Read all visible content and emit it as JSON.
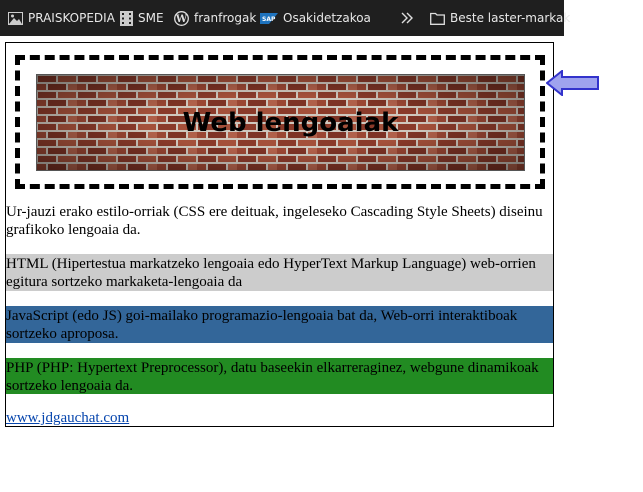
{
  "bookmarks": [
    {
      "label": "PRAISKOPEDIA",
      "icon": "image-icon"
    },
    {
      "label": "SME",
      "icon": "film-icon"
    },
    {
      "label": "franfrogak",
      "icon": "wordpress-icon"
    },
    {
      "label": "Osakidetzakoa",
      "icon": "sap-icon"
    }
  ],
  "more_icon": "chevron-double-right-icon",
  "folder": {
    "label": "Beste laster-markak",
    "icon": "folder-icon"
  },
  "banner": {
    "title": "Web lengoaiak"
  },
  "paragraphs": {
    "css": "Ur-jauzi erako estilo-orriak (CSS ere deituak, ingeleseko Cascading Style Sheets) diseinu grafikoko lengoaia da.",
    "html": "HTML (Hipertestua markatzeko lengoaia edo HyperText Markup Language) web-orrien egitura sortzeko markaketa-lengoaia da",
    "js": "JavaScript (edo JS) goi-mailako programazio-lengoaia bat da, Web-orri interaktiboak sortzeko aproposa.",
    "php": "PHP (PHP: Hypertext Preprocessor), datu baseekin elkarreraginez, webgune dinamikoak sortzeko lengoaia da."
  },
  "link": {
    "text": "www.jdgauchat.com"
  },
  "colors": {
    "bookmark_bar": "#1f1f1f",
    "html_bg": "#cccccc",
    "js_bg": "#336699",
    "php_bg": "#228b22",
    "link": "#0645ad",
    "arrow": "#3333cc"
  }
}
